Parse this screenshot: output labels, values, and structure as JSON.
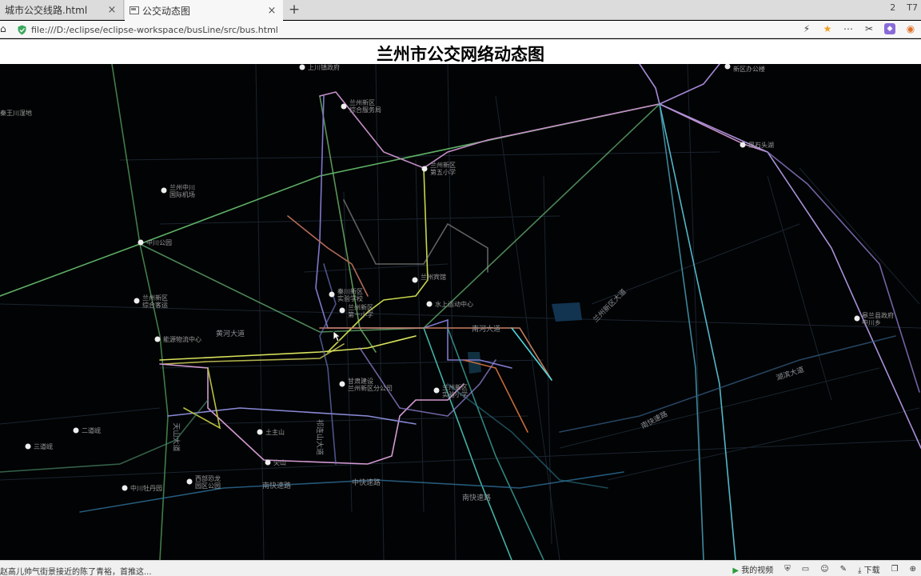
{
  "browser": {
    "tabs": [
      {
        "title": "城市公交线路.html",
        "close": "×"
      },
      {
        "title": "公交动态图",
        "close": "×"
      }
    ],
    "new_tab": "+",
    "right_badges": [
      "2",
      "T7"
    ],
    "url": "file:///D:/eclipse/eclipse-workspace/busLine/src/bus.html",
    "home_icon": "home-icon",
    "nav_icons": [
      "lightning-icon",
      "star-icon",
      "more-icon",
      "scissors-icon",
      "extension-icon",
      "game-icon"
    ]
  },
  "page": {
    "title": "兰州市公交网络动态图"
  },
  "map": {
    "pois": [
      {
        "label": "兰州新区\n综合服务局"
      },
      {
        "label": "兰州新区\n第五小学"
      },
      {
        "label": "兰州中川\n国际机场"
      },
      {
        "label": "中川公园"
      },
      {
        "label": "兰州新区\n综合客运"
      },
      {
        "label": "兰州宾馆"
      },
      {
        "label": "兰州新区\n第一小学"
      },
      {
        "label": "秦川新区\n实验学校"
      },
      {
        "label": "水上运动中心"
      },
      {
        "label": "能源物流中心"
      },
      {
        "label": "甘肃建设\n兰州新区分公司"
      },
      {
        "label": "兰州新区\n实验小学"
      },
      {
        "label": "二道岘"
      },
      {
        "label": "土主山"
      },
      {
        "label": "三道岘"
      },
      {
        "label": "中川牡丹园"
      },
      {
        "label": "西部恐龙\n园区公园"
      },
      {
        "label": "尖山"
      },
      {
        "label": "秦王川湿地"
      },
      {
        "label": "上川镇政府"
      },
      {
        "label": "皋兰县政府\n中川乡"
      },
      {
        "label": "黑石头湖"
      },
      {
        "label": "新区办公楼"
      }
    ],
    "roads": [
      "黄河大道",
      "南河大道",
      "南快速路",
      "中快速路",
      "南快速路",
      "天山大道",
      "祁连山大道",
      "兰州新区大道",
      "南快速路",
      "湖滨大道"
    ],
    "accent_colors": [
      "#66c47a",
      "#d49ad4",
      "#4fa3c9",
      "#c98a59",
      "#9b8be0",
      "#c3d25a",
      "#54c2b6"
    ]
  },
  "status": {
    "left_text": "赵高儿帅气街景接近的陈了青裕，首推这...",
    "right_items": [
      {
        "label": "我的视频",
        "icon": "play-icon"
      },
      {
        "label": "",
        "icon": "shield-icon"
      },
      {
        "label": "",
        "icon": "screen-icon"
      },
      {
        "label": "",
        "icon": "face-icon"
      },
      {
        "label": "",
        "icon": "brush-icon"
      },
      {
        "label": "下载",
        "icon": "download-icon"
      },
      {
        "label": "",
        "icon": "window-icon"
      },
      {
        "label": "",
        "icon": "zoom-icon"
      }
    ]
  }
}
